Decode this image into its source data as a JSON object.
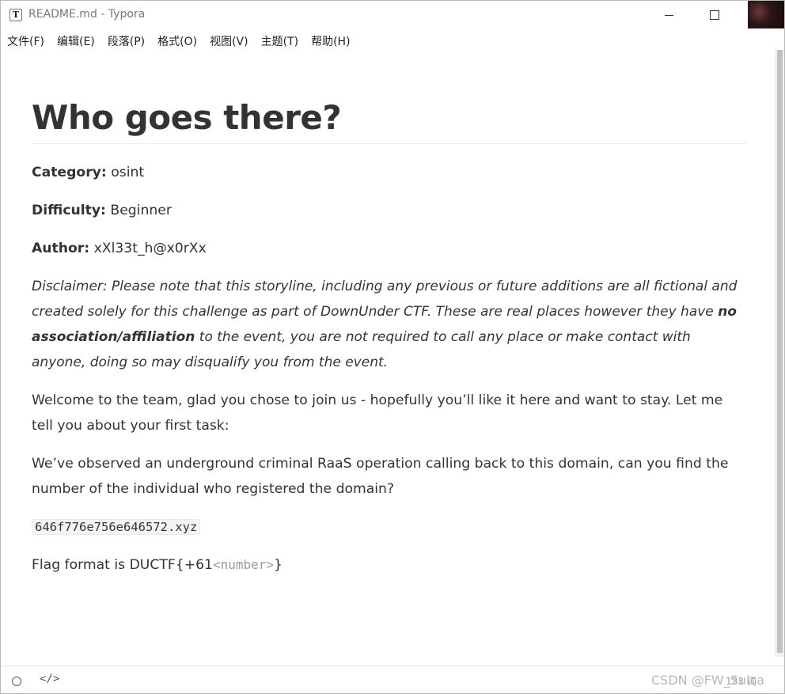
{
  "window": {
    "title": "README.md - Typora",
    "app_icon_letter": "T"
  },
  "menu": {
    "items": [
      {
        "label": "文件(F)"
      },
      {
        "label": "编辑(E)"
      },
      {
        "label": "段落(P)"
      },
      {
        "label": "格式(O)"
      },
      {
        "label": "视图(V)"
      },
      {
        "label": "主题(T)"
      },
      {
        "label": "帮助(H)"
      }
    ]
  },
  "document": {
    "heading": "Who goes there?",
    "category_label": "Category:",
    "category_value": "osint",
    "difficulty_label": "Difficulty:",
    "difficulty_value": "Beginner",
    "author_label": "Author:",
    "author_value": "xXl33t_h@x0rXx",
    "disclaimer_part1": "Disclaimer: Please note that this storyline, including any previous or future additions are all fictional and created solely for this challenge as part of DownUnder CTF. These are real places however they have ",
    "disclaimer_strong": "no association/affiliation",
    "disclaimer_part2": " to the event, you are not required to call any place or make contact with anyone, doing so may disqualify you from the event.",
    "welcome": "Welcome to the team, glad you chose to join us - hopefully you’ll like it here and want to stay. Let me tell you about your first task:",
    "task": "We’ve observed an underground criminal RaaS operation calling back to this domain, can you find the number of the individual who registered the domain?",
    "domain_code": "646f776e756e646572.xyz",
    "flag_prefix": "Flag format is DUCTF{+61",
    "flag_placeholder": "<number>",
    "flag_suffix": "}"
  },
  "statusbar": {
    "word_count": "123 词",
    "watermark": "CSDN @FW_Suica"
  },
  "icons": {
    "outline_toggle": "circle-icon",
    "source_mode": "code-icon"
  }
}
